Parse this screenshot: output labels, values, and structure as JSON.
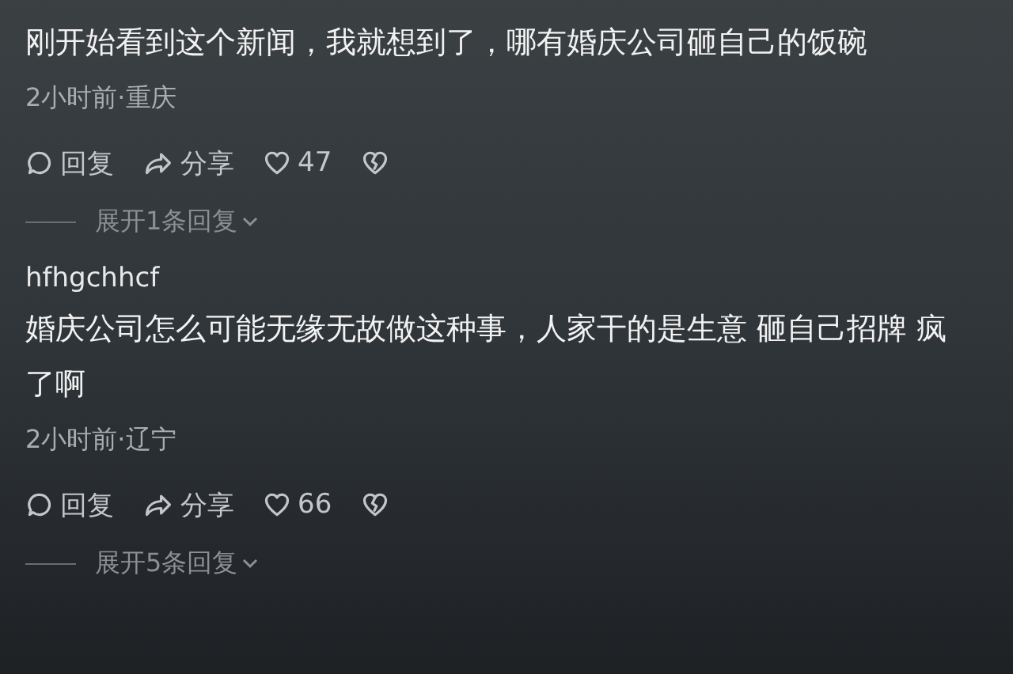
{
  "comments": [
    {
      "text": "刚开始看到这个新闻，我就想到了，哪有婚庆公司砸自己的饭碗",
      "meta": "2小时前·重庆",
      "reply": "回复",
      "share": "分享",
      "likes": "47",
      "expand": "展开1条回复"
    },
    {
      "username": "hfhgchhcf",
      "text": "婚庆公司怎么可能无缘无故做这种事，人家干的是生意 砸自己招牌 疯了啊",
      "meta": "2小时前·辽宁",
      "reply": "回复",
      "share": "分享",
      "likes": "66",
      "expand": "展开5条回复"
    }
  ]
}
